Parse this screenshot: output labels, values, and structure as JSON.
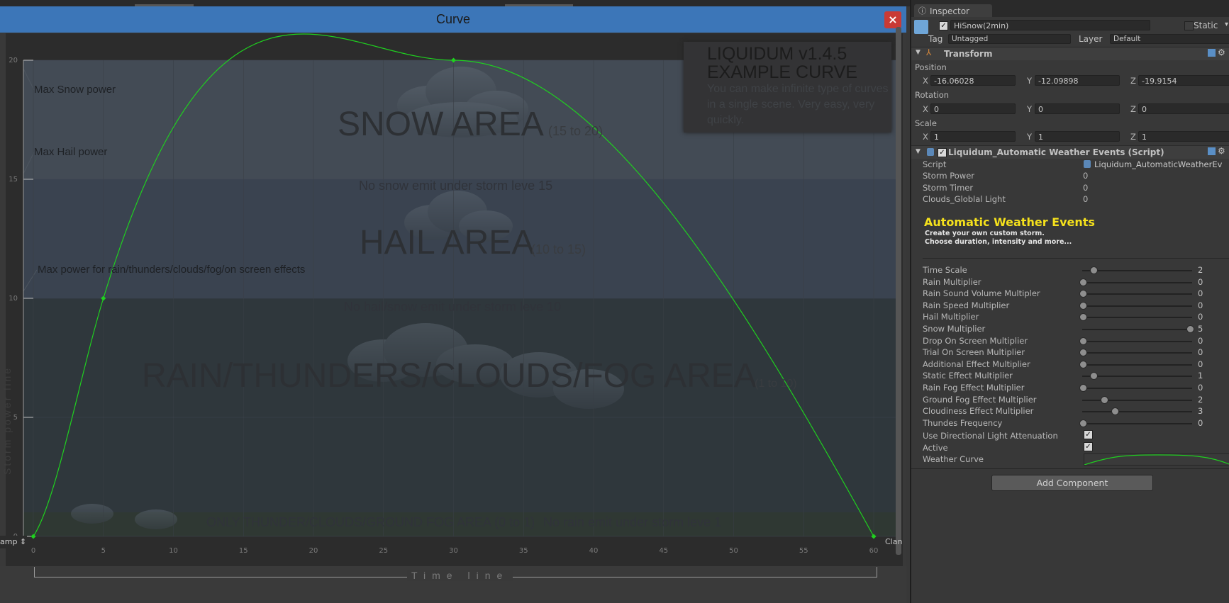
{
  "curve_window": {
    "title": "Curve",
    "close_glyph": "×",
    "wrap_mode_left": "amp",
    "wrap_mode_right": "Clan",
    "storm_line_label": "Storm power line",
    "timeline_label": "Time line",
    "liquidum_title_line1": "LIQUIDUM v1.4.5",
    "liquidum_title_line2": "EXAMPLE CURVE",
    "liquidum_desc": "You can make infinite type of curves in a single scene. Very easy, very quickly.",
    "zones": {
      "snow": {
        "title": "SNOW AREA",
        "range": "(15 to 20)",
        "note": "No snow emit under storm leve 15"
      },
      "hail": {
        "title": "HAIL AREA",
        "range": "(10 to 15)",
        "note": "No hail/snow emit under storm leve 10"
      },
      "rain": {
        "title": "RAIN/THUNDERS/CLOUDS/FOG AREA",
        "range": "(1 to 10)"
      },
      "thunder": {
        "title": "ONLY THUNDER/CLOUDS/GROUND FOG AREA (0 to 1)",
        "note": "No rain emit under storm leve 1"
      }
    },
    "annotations": {
      "max_snow": "Max Snow power",
      "max_hail": "Max Hail power",
      "max_rain": "Max power for rain/thunders/clouds/fog/on screen effects"
    },
    "colors": {
      "curve": "#1fd01f",
      "titlebar": "#3c76b8",
      "close": "#c93a35"
    }
  },
  "chart_data": {
    "type": "line",
    "x": [
      0,
      5,
      30,
      60
    ],
    "series": [
      {
        "values": [
          0,
          10,
          20,
          0
        ]
      }
    ],
    "xticks": [
      "0",
      "5",
      "10",
      "15",
      "20",
      "25",
      "30",
      "35",
      "40",
      "45",
      "50",
      "55",
      "60"
    ],
    "yticks": [
      "0",
      "5",
      "10",
      "15",
      "20"
    ],
    "xlim": [
      0,
      60
    ],
    "ylim": [
      0,
      20
    ],
    "grid": true
  },
  "inspector": {
    "tab_title": "Inspector",
    "object_name": "HiSnow(2min)",
    "static_label": "Static",
    "tag_label": "Tag",
    "tag_value": "Untagged",
    "layer_label": "Layer",
    "layer_value": "Default",
    "transform": {
      "title": "Transform",
      "position_label": "Position",
      "position": {
        "x": "-16.06028",
        "y": "-12.09898",
        "z": "-19.9154"
      },
      "rotation_label": "Rotation",
      "rotation": {
        "x": "0",
        "y": "0",
        "z": "0"
      },
      "scale_label": "Scale",
      "scale": {
        "x": "1",
        "y": "1",
        "z": "1"
      }
    },
    "script": {
      "title": "Liquidum_Automatic Weather Events (Script)",
      "script_label": "Script",
      "script_value": "Liquidum_AutomaticWeatherEv",
      "fields": [
        {
          "label": "Storm Power",
          "value": "0"
        },
        {
          "label": "Storm Timer",
          "value": "0"
        },
        {
          "label": "Clouds_Globlal Light",
          "value": "0"
        }
      ],
      "heading": "Automatic Weather Events",
      "subheading_1": "Create your own custom storm.",
      "subheading_2": "Choose duration, intensity and more...",
      "sliders": [
        {
          "label": "Time Scale",
          "value": "2",
          "level": 0.1
        },
        {
          "label": "Rain Multiplier",
          "value": "0",
          "level": 0.0
        },
        {
          "label": "Rain Sound Volume Multipler",
          "value": "0",
          "level": 0.0
        },
        {
          "label": "Rain Speed Multiplier",
          "value": "0",
          "level": 0.0
        },
        {
          "label": "Hail Multiplier",
          "value": "0",
          "level": 0.0
        },
        {
          "label": "Snow Multiplier",
          "value": "5",
          "level": 1.0
        },
        {
          "label": "Drop On Screen Multiplier",
          "value": "0",
          "level": 0.0
        },
        {
          "label": "Trial On Screen Multiplier",
          "value": "0",
          "level": 0.0
        },
        {
          "label": "Additional Effect Multiplier",
          "value": "0",
          "level": 0.0
        },
        {
          "label": "Static Effect Multiplier",
          "value": "1",
          "level": 0.1
        },
        {
          "label": "Rain Fog Effect Multiplier",
          "value": "0",
          "level": 0.0
        },
        {
          "label": "Ground Fog Effect Multiplier",
          "value": "2",
          "level": 0.2
        },
        {
          "label": "Cloudiness Effect Multiplier",
          "value": "3",
          "level": 0.3
        },
        {
          "label": "Thundes Frequency",
          "value": "0",
          "level": 0.0
        }
      ],
      "use_directional_label": "Use Directional Light Attenuation",
      "active_label": "Active",
      "weather_curve_label": "Weather Curve",
      "check_glyph": "✓"
    },
    "add_component": "Add Component"
  }
}
